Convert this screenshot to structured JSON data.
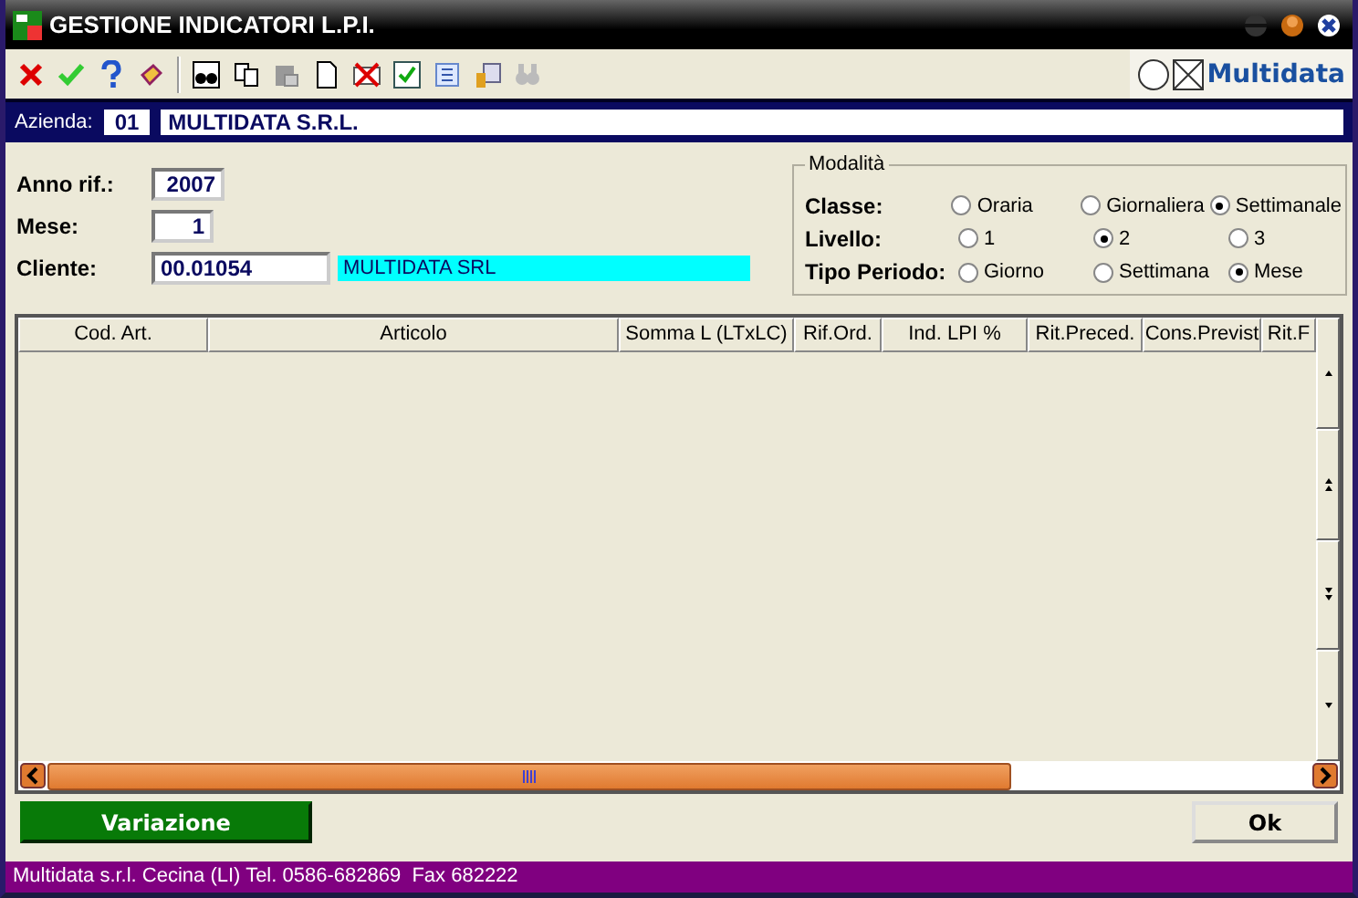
{
  "window": {
    "title": "GESTIONE INDICATORI L.P.I."
  },
  "toolbar": {
    "brand": "Multidata"
  },
  "company": {
    "label": "Azienda:",
    "code": "01",
    "name": "MULTIDATA S.R.L."
  },
  "fields": [
    {
      "label": "Anno rif.:",
      "value": "2007",
      "kind": "short"
    },
    {
      "label": "Mese:",
      "value": "1",
      "kind": "tiny"
    },
    {
      "label": "Cliente:",
      "value": "00.01054",
      "kind": "lookup",
      "description": "MULTIDATA SRL"
    }
  ],
  "modalita": {
    "title": "Modalità",
    "groups": [
      {
        "label": "Classe:",
        "options": [
          {
            "label": "Oraria",
            "selected": false
          },
          {
            "label": "Giornaliera",
            "selected": false
          },
          {
            "label": "Settimanale",
            "selected": true
          }
        ]
      },
      {
        "label": "Livello:",
        "options": [
          {
            "label": "1",
            "selected": false
          },
          {
            "label": "2",
            "selected": true
          },
          {
            "label": "3",
            "selected": false
          }
        ]
      },
      {
        "label": "Tipo Periodo:",
        "options": [
          {
            "label": "Giorno",
            "selected": false
          },
          {
            "label": "Settimana",
            "selected": false
          },
          {
            "label": "Mese",
            "selected": true
          }
        ]
      }
    ]
  },
  "table": {
    "columns": [
      "Cod. Art.",
      "Articolo",
      "Somma L (LTxLC)",
      "Rif.Ord.",
      "Ind. LPI %",
      "Rit.Preced.",
      "Cons.Previst",
      "Rit.F"
    ]
  },
  "buttons": [
    {
      "label": "Variazione",
      "kind": "action"
    },
    {
      "label": "Ok",
      "kind": "default"
    }
  ],
  "status_bar": "Multidata s.r.l. Cecina (LI) Tel. 0586-682869  Fax 682222"
}
